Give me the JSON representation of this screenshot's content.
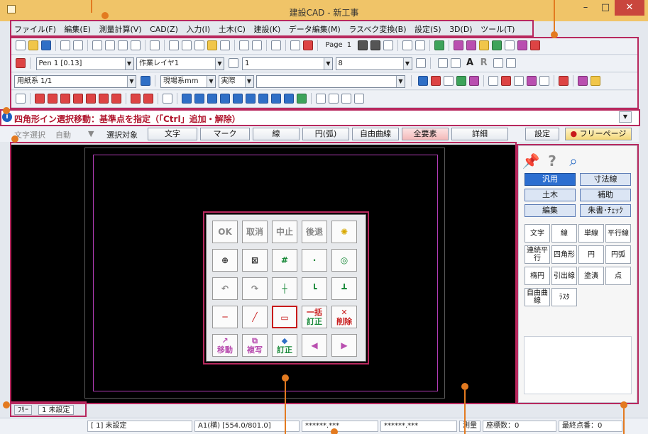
{
  "window": {
    "title": "建設CAD - 新工事",
    "min": "–",
    "max": "□",
    "close": "✕"
  },
  "menu": [
    "ファイル(F)",
    "編集(E)",
    "測量計算(V)",
    "CAD(Z)",
    "入力(I)",
    "土木(C)",
    "建設(K)",
    "データ編集(M)",
    "ラスベク変換(B)",
    "設定(S)",
    "3D(D)",
    "ツール(T)",
    "ヘルプ(H)"
  ],
  "toolbar": {
    "page_label": "Page",
    "page_number": "1",
    "pen_combo": "Pen 1 [0.13]",
    "layer_combo": "作業レイヤ1",
    "line_combo": "1",
    "width_combo": "8",
    "paper_combo": "用紙系 1/1",
    "unit_combo": "現場系mm",
    "scale_combo": "実際",
    "text_A": "A",
    "text_R": "R"
  },
  "status_message": "四角形イン選択移動：基準点を指定（「Ctrl」追加・解除）",
  "selection_bar": {
    "text_select": "文字選択",
    "auto": "自動",
    "target": "選択対象",
    "buttons": [
      "文字",
      "マーク",
      "線",
      "円(弧)",
      "自由曲線",
      "全要素",
      "詳細"
    ],
    "settings": "設定",
    "free_page": "フリーページ"
  },
  "palette": {
    "row1": [
      "OK",
      "取消",
      "中止",
      "後退"
    ],
    "ikkatsu": "一括",
    "teisei": "訂正",
    "sakujo": "削除",
    "ido": "移動",
    "fukusha": "複写"
  },
  "right_panel": {
    "tabs": [
      "汎用",
      "寸法線",
      "土木",
      "補助",
      "編集",
      "朱書･ﾁｪｯｸ"
    ],
    "tools": [
      "文字",
      "線",
      "単線",
      "平行線",
      "連続平行",
      "四角形",
      "円",
      "円弧",
      "楕円",
      "引出線",
      "塗潰",
      "点",
      "自由曲線",
      "ﾗｽﾀ"
    ]
  },
  "sheet_tabs": {
    "free": "ﾌﾘｰ",
    "sheet1": "1 未設定"
  },
  "status_bar": {
    "sheet": "[ 1] 未設定",
    "paper": "A1(横) [554.0/801.0]",
    "x": "******.***",
    "y": "******.***",
    "survey": "測量",
    "coord_count": "座標数：0",
    "last_point": "最終点番：0"
  },
  "colors": {
    "title_bar": "#f0c468",
    "highlight_frame": "#b8285e",
    "annotation": "#e37a20",
    "message": "#b0142c"
  }
}
